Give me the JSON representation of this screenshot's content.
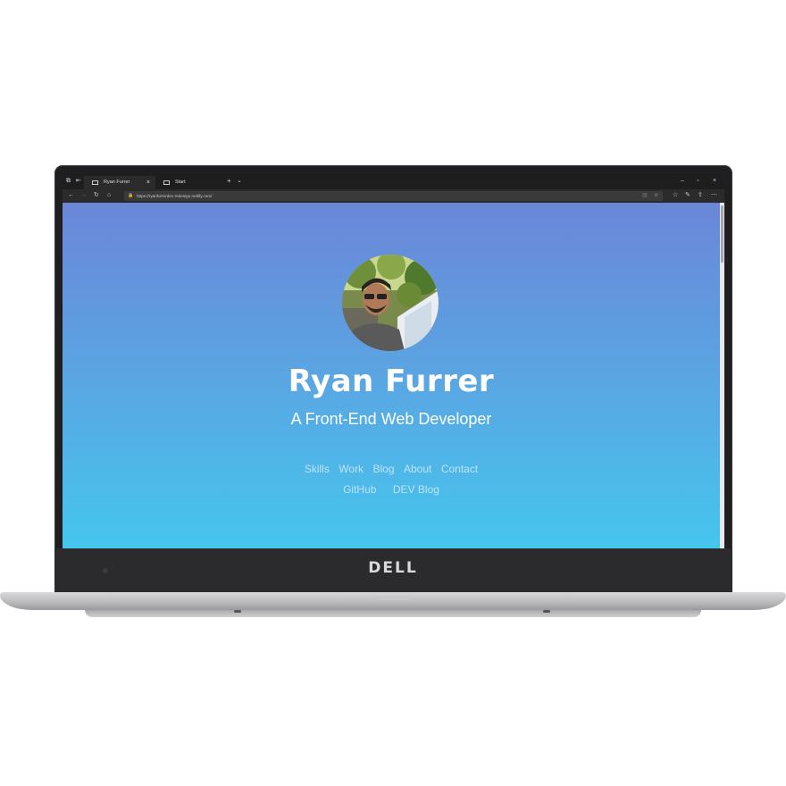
{
  "browser": {
    "tabs": [
      {
        "label": "Ryan Furrer",
        "active": true
      },
      {
        "label": "Start",
        "active": false
      }
    ],
    "new_tab_icon": "plus-icon",
    "url": "https://ryanfurrerdev-redesign.netlify.com/",
    "window_controls": [
      "minimize-icon",
      "restore-icon",
      "close-icon"
    ]
  },
  "page": {
    "name": "Ryan Furrer",
    "tagline": "A Front-End Web Developer",
    "nav_primary": [
      "Skills",
      "Work",
      "Blog",
      "About",
      "Contact"
    ],
    "nav_secondary": [
      "GitHub",
      "DEV Blog"
    ],
    "gradient_top": "#6b86d8",
    "gradient_bottom": "#45c6ee"
  },
  "device": {
    "brand": "DELL"
  }
}
